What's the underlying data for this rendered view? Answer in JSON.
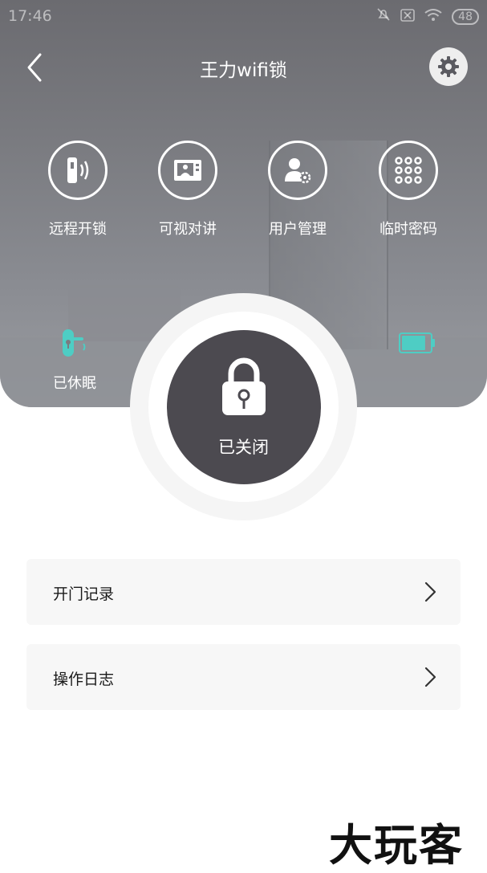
{
  "status_bar": {
    "time": "17:46",
    "battery": "48"
  },
  "header": {
    "title": "王力wifi锁"
  },
  "actions": [
    {
      "label": "远程开锁",
      "icon": "remote-unlock-icon"
    },
    {
      "label": "可视对讲",
      "icon": "video-intercom-icon"
    },
    {
      "label": "用户管理",
      "icon": "user-management-icon"
    },
    {
      "label": "临时密码",
      "icon": "keypad-icon"
    }
  ],
  "device": {
    "sleep_label": "已休眠",
    "battery_color": "#4ecdc4",
    "battery_level": 0.85
  },
  "lock": {
    "status": "已关闭"
  },
  "menu": [
    {
      "label": "开门记录"
    },
    {
      "label": "操作日志"
    }
  ],
  "watermark": "大玩客"
}
